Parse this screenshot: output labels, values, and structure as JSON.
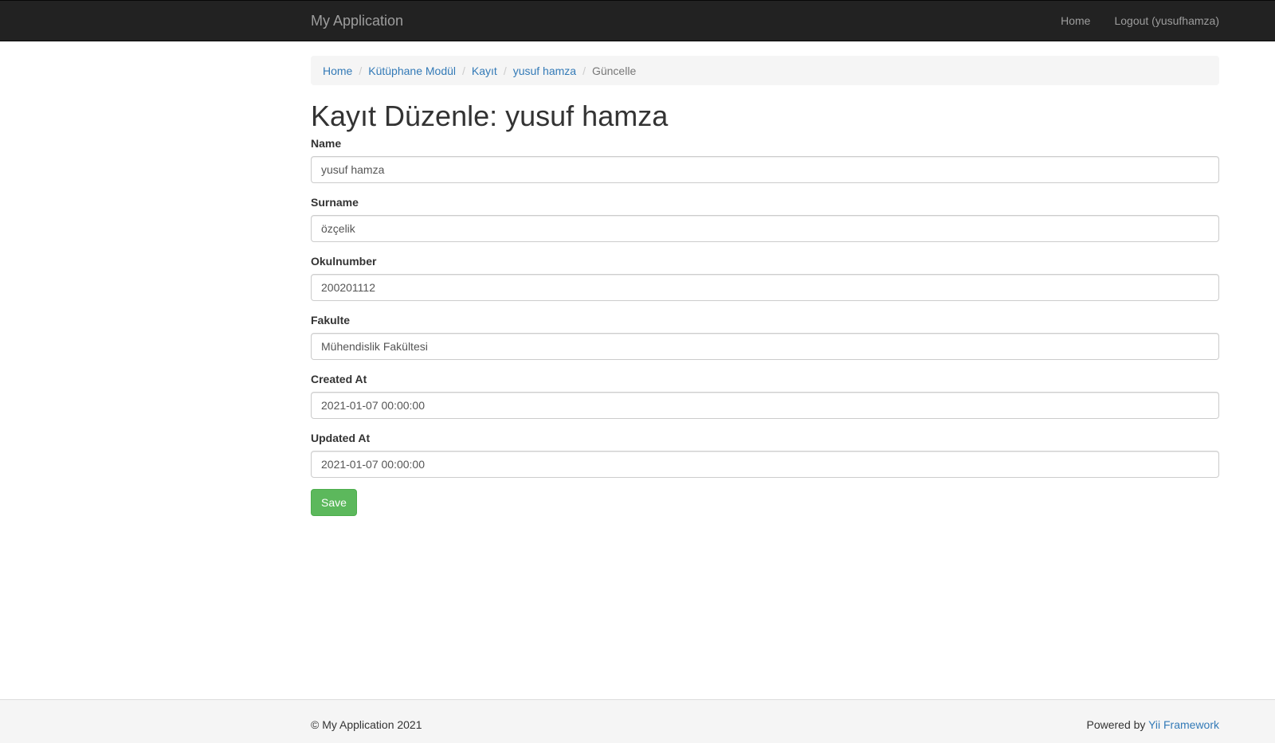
{
  "navbar": {
    "brand": "My Application",
    "links": [
      "Home",
      "Logout (yusufhamza)"
    ]
  },
  "breadcrumb": {
    "items": [
      "Home",
      "Kütüphane Modül",
      "Kayıt",
      "yusuf hamza"
    ],
    "active": "Güncelle",
    "separator": "/"
  },
  "page": {
    "title": "Kayıt Düzenle: yusuf hamza"
  },
  "form": {
    "fields": [
      {
        "label": "Name",
        "value": "yusuf hamza"
      },
      {
        "label": "Surname",
        "value": "özçelik"
      },
      {
        "label": "Okulnumber",
        "value": "200201112"
      },
      {
        "label": "Fakulte",
        "value": "Mühendislik Fakültesi"
      },
      {
        "label": "Created At",
        "value": "2021-01-07 00:00:00"
      },
      {
        "label": "Updated At",
        "value": "2021-01-07 00:00:00"
      }
    ],
    "save_label": "Save"
  },
  "footer": {
    "copyright": "© My Application 2021",
    "powered_prefix": "Powered by ",
    "powered_link": "Yii Framework"
  },
  "colors": {
    "navbar_bg": "#222222",
    "link": "#337ab7",
    "save_button": "#5cb85c"
  }
}
